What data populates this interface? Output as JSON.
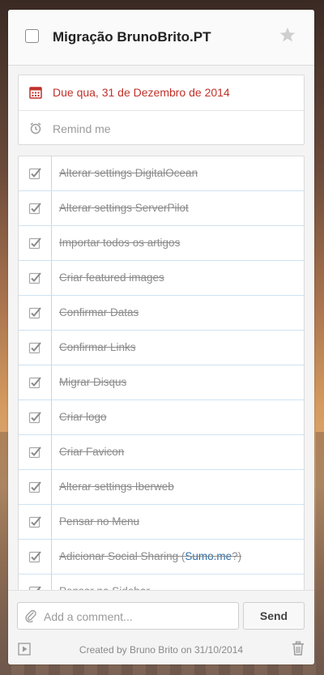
{
  "task": {
    "title": "Migração BrunoBrito.PT",
    "due_label": "Due qua, 31 de Dezembro de 2014",
    "remind_label": "Remind me"
  },
  "subtasks": [
    {
      "text": "Alterar settings DigitalOcean",
      "completed": true
    },
    {
      "text": "Alterar settings ServerPilot",
      "completed": true
    },
    {
      "text": "Importar todos os artigos",
      "completed": true
    },
    {
      "text": "Criar featured images",
      "completed": true
    },
    {
      "text": "Confirmar Datas",
      "completed": true
    },
    {
      "text": "Confirmar Links",
      "completed": true
    },
    {
      "text": "Migrar Disqus",
      "completed": true
    },
    {
      "text": "Criar logo",
      "completed": true
    },
    {
      "text": "Criar Favicon",
      "completed": true
    },
    {
      "text": "Alterar settings Iberweb",
      "completed": true
    },
    {
      "text": "Pensar no Menu",
      "completed": true
    },
    {
      "text_before": "Adicionar Social Sharing (",
      "link_text": "Sumo.me",
      "text_after": "?)",
      "completed": true
    },
    {
      "text": "Pensar na Sidebar",
      "completed": true
    }
  ],
  "footer": {
    "comment_placeholder": "Add a comment...",
    "send_label": "Send",
    "created_text": "Created by Bruno Brito on 31/10/2014"
  },
  "colors": {
    "due_red": "#c0312a",
    "link_blue": "#2f6fa8",
    "check_gray": "#9a9a9a"
  },
  "icons": {
    "star": "star-icon",
    "calendar": "calendar-icon",
    "alarm": "alarm-clock-icon",
    "attach": "paperclip-icon",
    "play": "play-icon",
    "trash": "trash-icon"
  }
}
